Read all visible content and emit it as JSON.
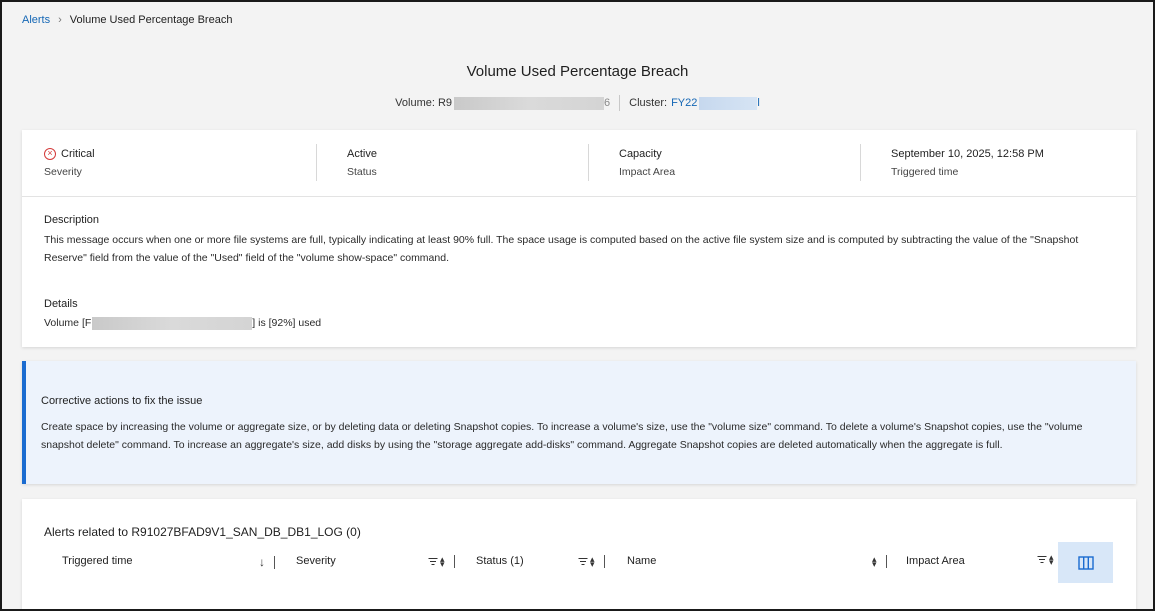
{
  "breadcrumb": {
    "root": "Alerts",
    "separator": "›",
    "current": "Volume Used Percentage Breach"
  },
  "page": {
    "title": "Volume Used Percentage Breach",
    "volume_label": "Volume: R9",
    "volume_tail": "6",
    "cluster_label": "Cluster:",
    "cluster_value": "FY22",
    "cluster_tail": "l"
  },
  "stats": [
    {
      "value": "Critical",
      "label": "Severity",
      "icon": "critical-x-circle-icon"
    },
    {
      "value": "Active",
      "label": "Status"
    },
    {
      "value": "Capacity",
      "label": "Impact Area"
    },
    {
      "value": "September 10, 2025, 12:58 PM",
      "label": "Triggered time"
    }
  ],
  "description": {
    "title": "Description",
    "text": "This message occurs when one or more file systems are full, typically indicating at least 90% full. The space usage is computed based on the active file system size and is computed by subtracting the value of the \"Snapshot Reserve\" field from the value of the \"Used\" field of the \"volume show-space\" command."
  },
  "details": {
    "title": "Details",
    "prefix": "Volume [F",
    "suffix": "] is [92%] used"
  },
  "corrective": {
    "title": "Corrective actions to fix the issue",
    "text": "Create space by increasing the volume or aggregate size, or by deleting data or deleting Snapshot copies. To increase a volume's size, use the \"volume size\" command. To delete a volume's Snapshot copies, use the \"volume snapshot delete\" command. To increase an aggregate's size, add disks by using the \"storage aggregate add-disks\" command. Aggregate Snapshot copies are deleted automatically when the aggregate is full."
  },
  "related": {
    "title": "Alerts related to R91027BFAD9V1_SAN_DB_DB1_LOG (0)",
    "columns": [
      "Triggered time",
      "Severity",
      "Status (1)",
      "Name",
      "Impact Area"
    ],
    "column_toggle_icon": "columns-icon"
  },
  "colors": {
    "accent": "#1567b5",
    "critical": "#d43a3a",
    "info_bg": "#edf3fc",
    "info_border": "#1a6bd0"
  }
}
